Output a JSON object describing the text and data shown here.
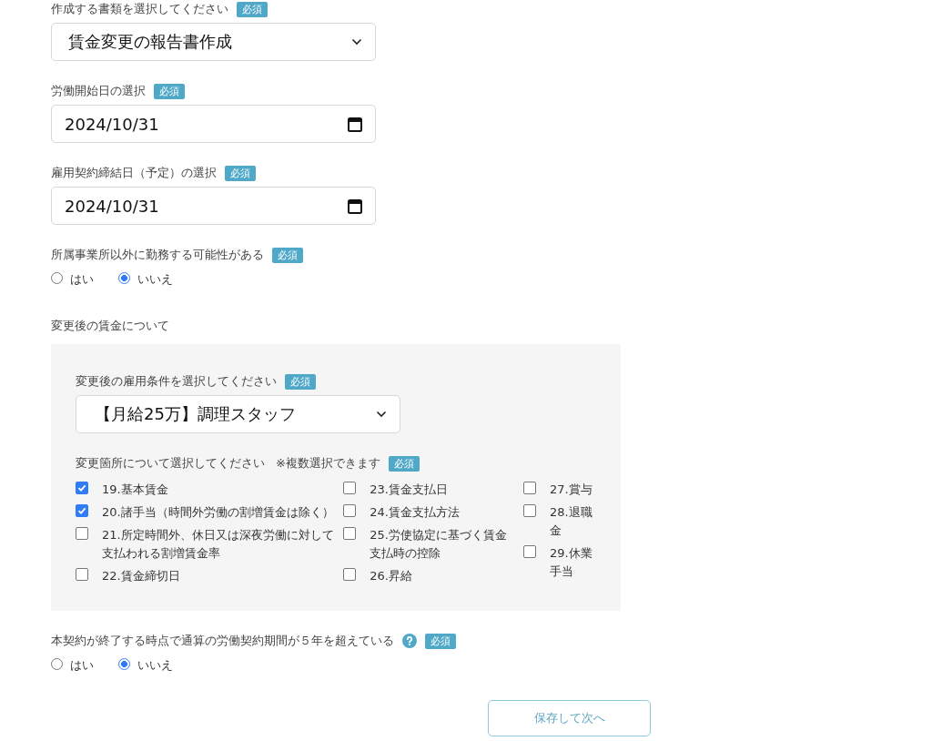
{
  "document_select": {
    "label": "作成する書類を選択してください",
    "required_badge": "必須",
    "value": "賃金変更の報告書作成"
  },
  "start_date": {
    "label": "労働開始日の選択",
    "required_badge": "必須",
    "value": "2024/10/31"
  },
  "contract_date": {
    "label": "雇用契約締結日（予定）の選択",
    "required_badge": "必須",
    "value": "2024/10/31"
  },
  "other_workplace": {
    "label": "所属事業所以外に勤務する可能性がある",
    "required_badge": "必須",
    "options": [
      {
        "label": "はい",
        "selected": false
      },
      {
        "label": "いいえ",
        "selected": true
      }
    ]
  },
  "wage_section": {
    "title": "変更後の賃金について",
    "condition_select": {
      "label": "変更後の雇用条件を選択してください",
      "required_badge": "必須",
      "value": "【月給25万】調理スタッフ"
    },
    "change_items": {
      "label": "変更箇所について選択してください",
      "note": "※複数選択できます",
      "required_badge": "必須",
      "columns": [
        {
          "items": [
            {
              "label": "19.基本賃金",
              "checked": true
            },
            {
              "label": "20.諸手当（時間外労働の割増賃金は除く）",
              "checked": true
            },
            {
              "label": "21.所定時間外、休日又は深夜労働に対して支払われる割増賃金率",
              "checked": false
            },
            {
              "label": "22.賃金締切日",
              "checked": false
            }
          ]
        },
        {
          "items": [
            {
              "label": "23.賃金支払日",
              "checked": false
            },
            {
              "label": "24.賃金支払方法",
              "checked": false
            },
            {
              "label": "25.労使協定に基づく賃金支払時の控除",
              "checked": false
            },
            {
              "label": "26.昇給",
              "checked": false
            }
          ]
        },
        {
          "items": [
            {
              "label": "27.賞与",
              "checked": false
            },
            {
              "label": "28.退職金",
              "checked": false
            },
            {
              "label": "29.休業手当",
              "checked": false
            }
          ]
        }
      ]
    }
  },
  "five_year": {
    "label": "本契約が終了する時点で通算の労働契約期間が５年を超えている",
    "required_badge": "必須",
    "options": [
      {
        "label": "はい",
        "selected": false
      },
      {
        "label": "いいえ",
        "selected": true
      }
    ]
  },
  "save_button": "保存して次へ"
}
